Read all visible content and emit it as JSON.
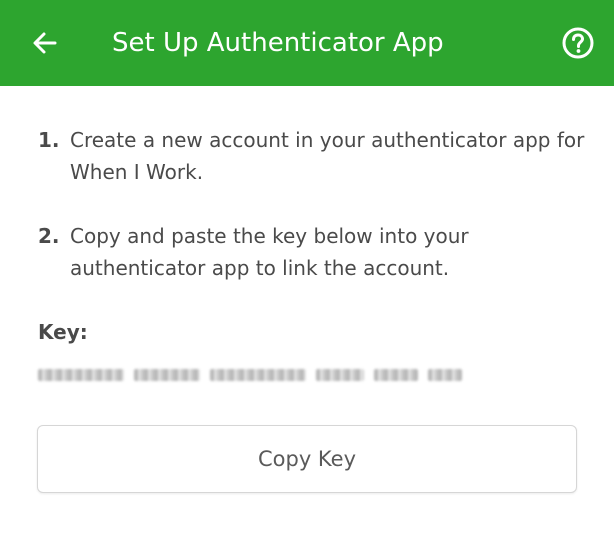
{
  "header": {
    "title": "Set Up Authenticator App",
    "back_icon": "arrow-left-icon",
    "help_icon": "question-circle-icon",
    "background_color": "#2da52f"
  },
  "steps": [
    {
      "number": "1.",
      "text": "Create a new account in your authenticator app for When I Work."
    },
    {
      "number": "2.",
      "text": "Copy and paste the key below into your authenticator app to link the account."
    }
  ],
  "key": {
    "label": "Key:",
    "value_obscured": true
  },
  "copy_button": {
    "label": "Copy Key"
  }
}
